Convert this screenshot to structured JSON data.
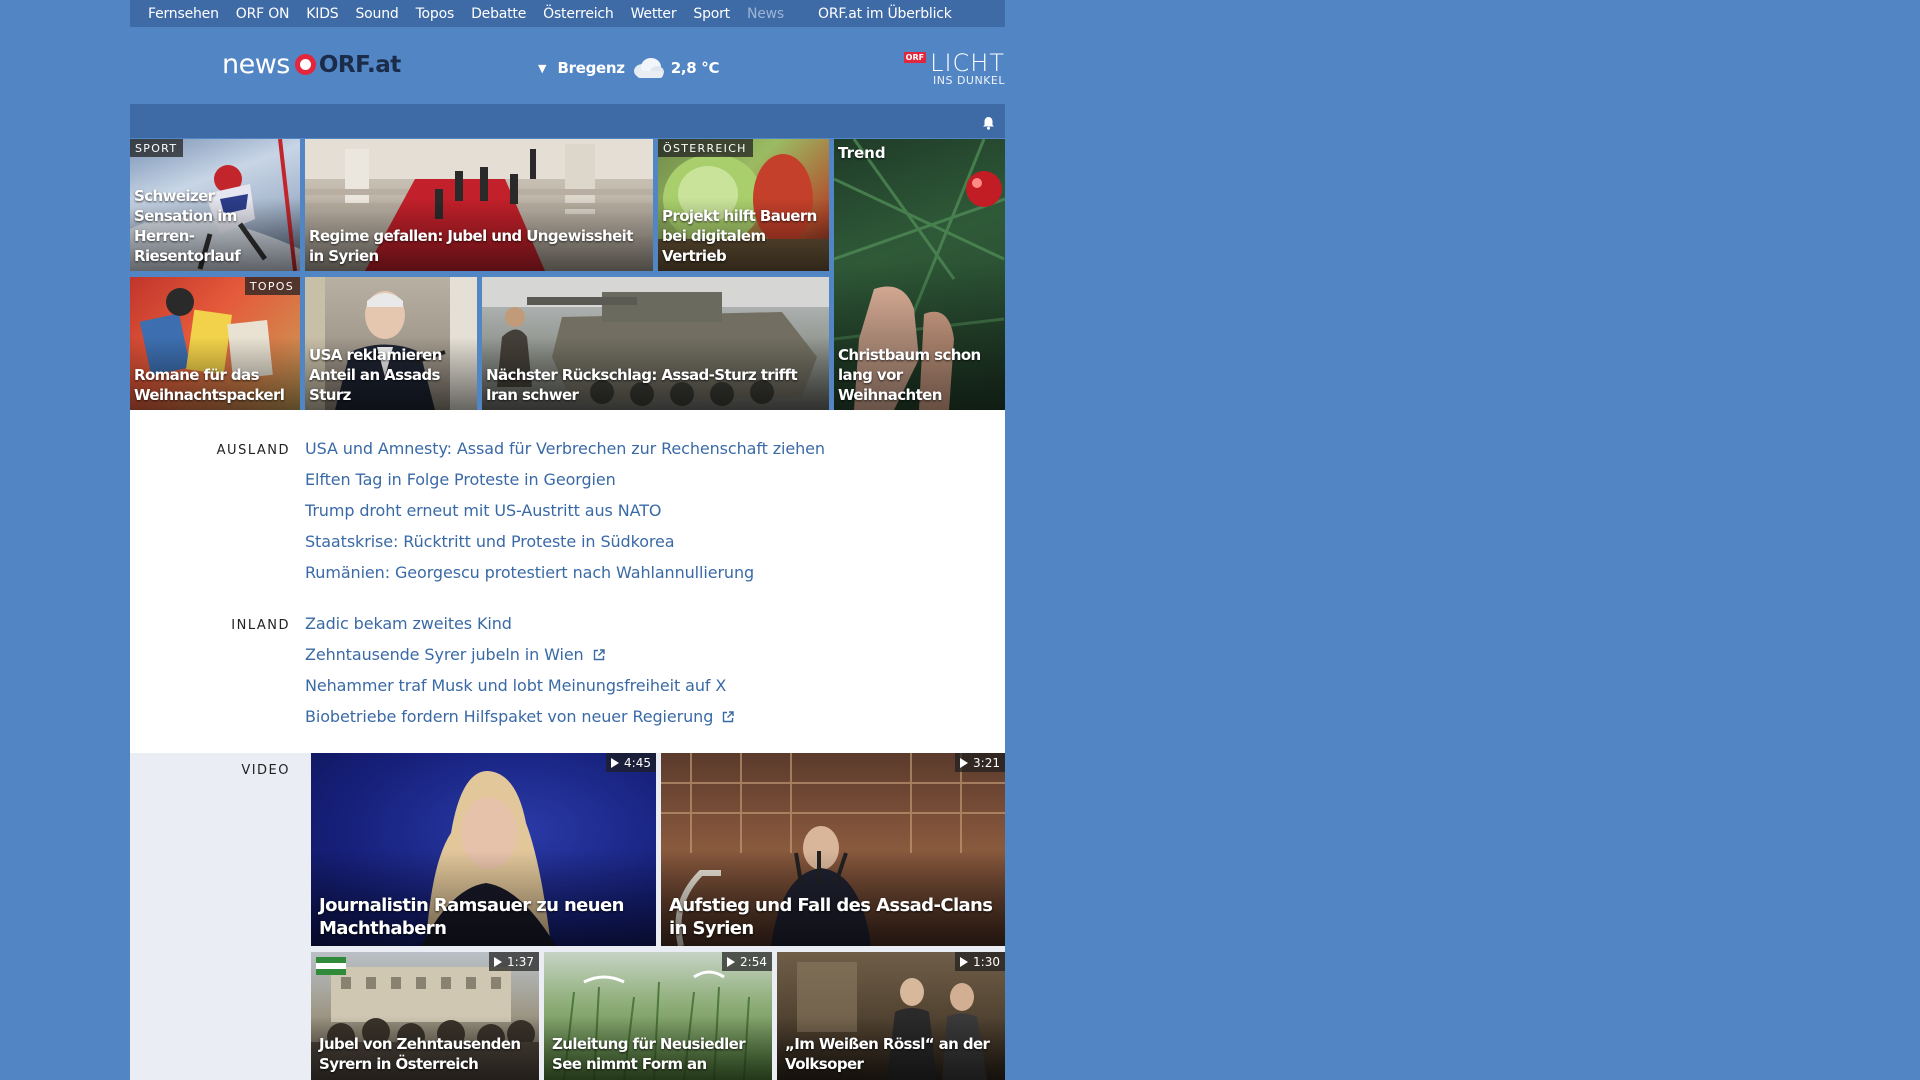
{
  "nav": {
    "items": [
      "Fernsehen",
      "ORF ON",
      "KIDS",
      "Sound",
      "Topos",
      "Debatte",
      "Österreich",
      "Wetter",
      "Sport",
      "News"
    ],
    "active": "News",
    "overview": "ORF.at im Überblick"
  },
  "header": {
    "logo_news": "news",
    "logo_orf": "ORF.at",
    "weather": {
      "city": "Bregenz",
      "temp": "2,8 °C",
      "icon": "cloud-icon"
    },
    "licht": {
      "orf": "ORF",
      "big": "LICHT",
      "small": "INS DUNKEL"
    }
  },
  "teasers": [
    {
      "tag": "SPORT",
      "title": "Schweizer Sensation im Herren-Riesentorlauf"
    },
    {
      "tag": "",
      "title": "Regime gefallen: Jubel und Ungewissheit in Syrien"
    },
    {
      "tag": "ÖSTERREICH",
      "title": "Projekt hilft Bauern bei digitalem Vertrieb"
    },
    {
      "tag": "Trend",
      "title": "Christbaum schon lang vor Weihnachten"
    },
    {
      "tag": "TOPOS",
      "title": "Romane für das Weihnachtspackerl"
    },
    {
      "tag": "",
      "title": "USA reklamieren Anteil an Assads Sturz"
    },
    {
      "tag": "",
      "title": "Nächster Rückschlag: Assad-Sturz trifft Iran schwer"
    }
  ],
  "sections": {
    "ausland": {
      "label": "AUSLAND",
      "links": [
        "USA und Amnesty: Assad für Verbrechen zur Rechenschaft ziehen",
        "Elften Tag in Folge Proteste in Georgien",
        "Trump droht erneut mit US-Austritt aus NATO",
        "Staatskrise: Rücktritt und Proteste in Südkorea",
        "Rumänien: Georgescu protestiert nach Wahlannullierung"
      ]
    },
    "inland": {
      "label": "INLAND",
      "links": [
        "Zadic bekam zweites Kind",
        "Zehntausende Syrer jubeln in Wien",
        "Nehammer traf Musk und lobt Meinungsfreiheit auf X",
        "Biobetriebe fordern Hilfspaket von neuer Regierung"
      ]
    }
  },
  "video": {
    "label": "VIDEO",
    "items": [
      {
        "duration": "4:45",
        "title": "Journalistin Ramsauer zu neuen Machthabern"
      },
      {
        "duration": "3:21",
        "title": "Aufstieg und Fall des Assad-Clans in Syrien"
      },
      {
        "duration": "1:37",
        "title": "Jubel von Zehntausenden Syrern in Österreich"
      },
      {
        "duration": "2:54",
        "title": "Zuleitung für Neusiedler See nimmt Form an"
      },
      {
        "duration": "1:30",
        "title": "„Im Weißen Rössl“ an der Volksoper"
      }
    ]
  }
}
